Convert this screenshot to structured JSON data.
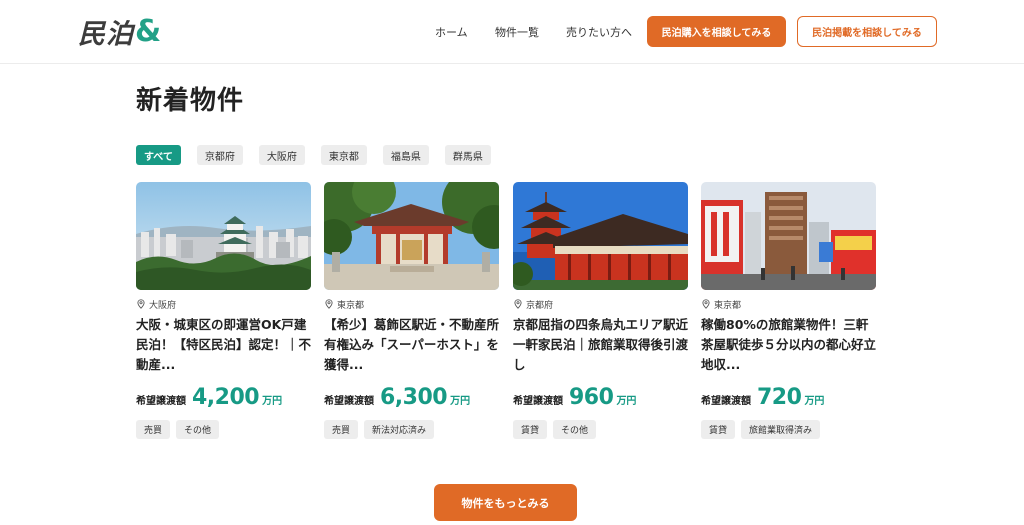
{
  "header": {
    "logo_text": "民泊",
    "logo_amp": "&",
    "nav": [
      "ホーム",
      "物件一覧",
      "売りたい方へ"
    ],
    "cta_primary": "民泊購入を相談してみる",
    "cta_secondary": "民泊掲載を相談してみる"
  },
  "section": {
    "title": "新着物件",
    "filters": [
      "すべて",
      "京都府",
      "大阪府",
      "東京都",
      "福島県",
      "群馬県"
    ],
    "active_filter": "すべて"
  },
  "listings": [
    {
      "location": "大阪府",
      "title": "大阪・城東区の即運営OK戸建民泊！【特区民泊】認定！｜不動産...",
      "price_label": "希望譲渡額",
      "price": "4,200",
      "unit": "万円",
      "tags": [
        "売買",
        "その他"
      ],
      "image": "osaka-castle-skyline"
    },
    {
      "location": "東京都",
      "title": "【希少】葛飾区駅近・不動産所有権込み「スーパーホスト」を獲得...",
      "price_label": "希望譲渡額",
      "price": "6,300",
      "unit": "万円",
      "tags": [
        "売買",
        "新法対応済み"
      ],
      "image": "shrine-gate"
    },
    {
      "location": "京都府",
      "title": "京都屈指の四条烏丸エリア駅近一軒家民泊｜旅館業取得後引渡し",
      "price_label": "希望譲渡額",
      "price": "960",
      "unit": "万円",
      "tags": [
        "賃貸",
        "その他"
      ],
      "image": "kyoto-pagoda"
    },
    {
      "location": "東京都",
      "title": "稼働80%の旅館業物件！三軒茶屋駅徒歩５分以内の都心好立地収...",
      "price_label": "希望譲渡額",
      "price": "720",
      "unit": "万円",
      "tags": [
        "賃貸",
        "旅館業取得済み"
      ],
      "image": "sangenjaya-street"
    }
  ],
  "more_button": "物件をもっとみる",
  "colors": {
    "accent_orange": "#e06a26",
    "accent_green": "#179a85"
  }
}
